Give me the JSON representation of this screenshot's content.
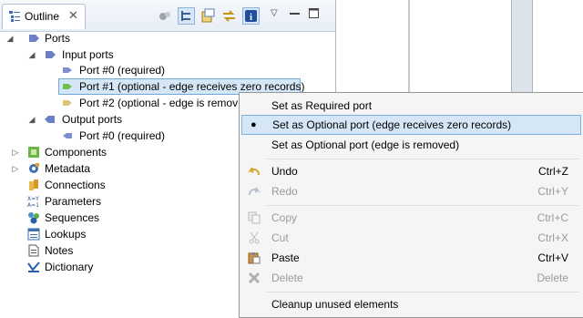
{
  "outline": {
    "tab_title": "Outline",
    "tree": {
      "ports": "Ports",
      "input_ports": "Input ports",
      "in_port0": "Port #0 (required)",
      "in_port1": "Port #1 (optional - edge receives zero records)",
      "in_port2": "Port #2 (optional - edge is remov",
      "output_ports": "Output ports",
      "out_port0": "Port #0 (required)",
      "components": "Components",
      "metadata": "Metadata",
      "connections": "Connections",
      "parameters": "Parameters",
      "sequences": "Sequences",
      "lookups": "Lookups",
      "notes": "Notes",
      "dictionary": "Dictionary"
    }
  },
  "menu": {
    "set_required": "Set as Required port",
    "set_optional_zero": "Set as Optional port (edge receives zero records)",
    "set_optional_removed": "Set as Optional port (edge is removed)",
    "undo": "Undo",
    "undo_key": "Ctrl+Z",
    "redo": "Redo",
    "redo_key": "Ctrl+Y",
    "copy": "Copy",
    "copy_key": "Ctrl+C",
    "cut": "Cut",
    "cut_key": "Ctrl+X",
    "paste": "Paste",
    "paste_key": "Ctrl+V",
    "delete": "Delete",
    "delete_key": "Delete",
    "cleanup": "Cleanup unused elements"
  }
}
